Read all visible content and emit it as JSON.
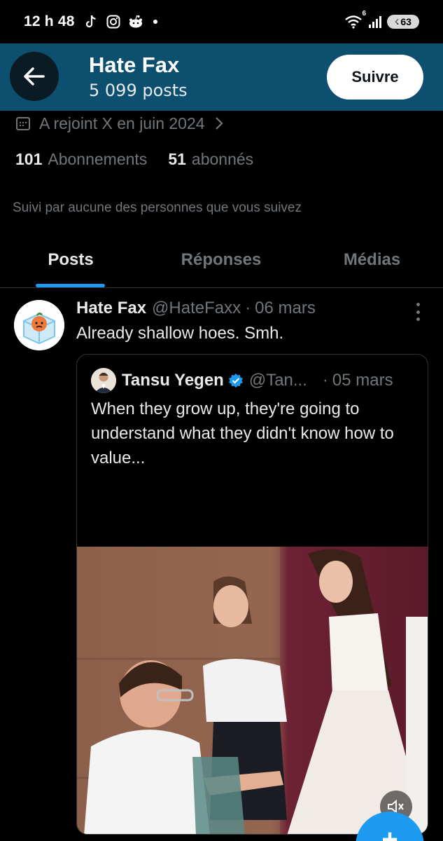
{
  "status_bar": {
    "time": "12 h 48",
    "icons": [
      "tiktok-icon",
      "instagram-icon",
      "reddit-icon"
    ],
    "network_badge": "6",
    "battery": "63"
  },
  "header": {
    "back_icon": "arrow-left-icon",
    "title": "Hate Fax",
    "subtitle": "5 099 posts",
    "follow_label": "Suivre"
  },
  "profile": {
    "joined": "A rejoint X en juin 2024",
    "following_count": "101",
    "following_label": "Abonnements",
    "followers_count": "51",
    "followers_label": "abonnés",
    "followed_by": "Suivi par aucune des personnes que vous suivez"
  },
  "tabs": [
    {
      "label": "Posts",
      "active": true
    },
    {
      "label": "Réponses",
      "active": false
    },
    {
      "label": "Médias",
      "active": false
    }
  ],
  "post": {
    "author_name": "Hate Fax",
    "author_handle": "@HateFaxx",
    "separator": "·",
    "date": "06 mars",
    "text": "Already shallow hoes. Smh.",
    "quote": {
      "author_name": "Tansu Yegen",
      "author_handle": "@Tan...",
      "separator": "·",
      "date": "05 mars",
      "text": "When they grow up, they're going to understand what they didn't know how to value...",
      "media_type": "video",
      "mute_icon": "speaker-muted-icon"
    }
  },
  "fab": {
    "icon": "plus-icon",
    "label": "+"
  },
  "colors": {
    "header_bg": "#0c4f6f",
    "accent": "#1d9bf0",
    "muted_text": "#71767b",
    "primary_text": "#e7e9ea",
    "border": "#2f3336"
  }
}
